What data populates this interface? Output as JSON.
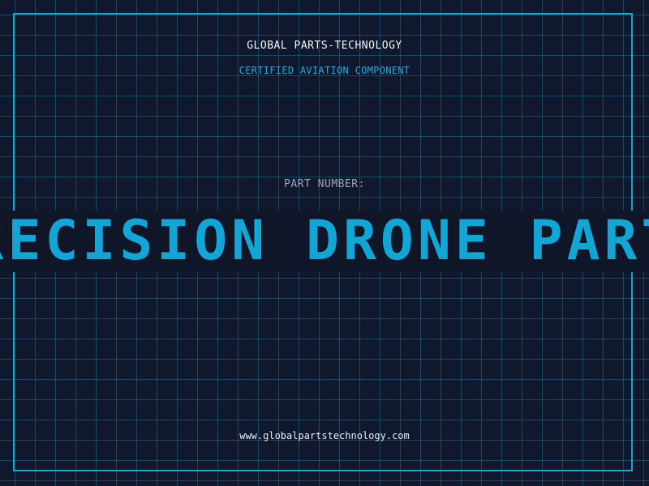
{
  "header": {
    "brand": "GLOBAL PARTS-TECHNOLOGY",
    "tagline": "CERTIFIED AVIATION COMPONENT"
  },
  "main": {
    "part_label": "PART NUMBER:",
    "part_name": "PRECISION DRONE PARTS"
  },
  "footer": {
    "url": "www.globalpartstechnology.com"
  },
  "colors": {
    "background": "#0f182c",
    "accent": "#1aa3cc",
    "banner_text": "#11a6d6"
  }
}
